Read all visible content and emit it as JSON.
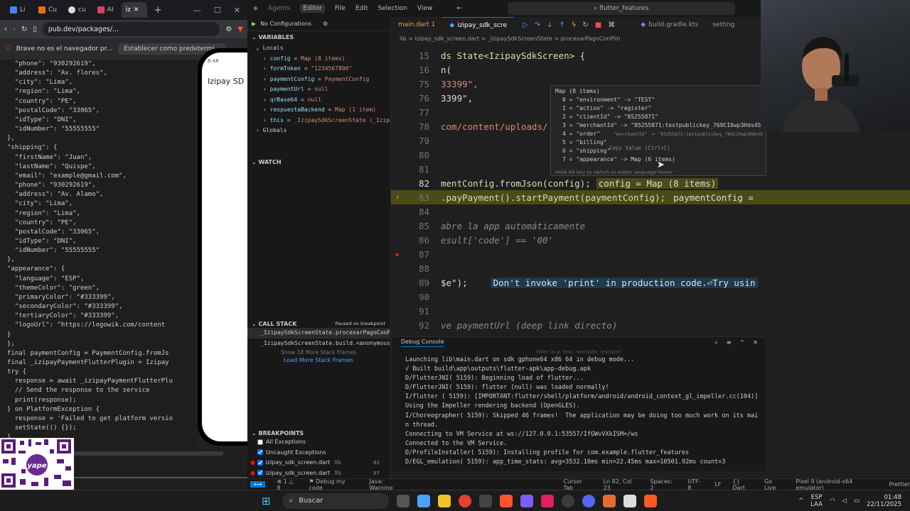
{
  "browser": {
    "tabs": [
      "Li",
      "Cu",
      "cu",
      "AI",
      "iz"
    ],
    "url": "pub.dev/packages/...",
    "brave_msg": "Brave no es el navegador pr...",
    "brave_btn": "Establecer como predetermi...",
    "code_lines": [
      [
        "  \"phone\": \"930292619\","
      ],
      [
        "  \"address\": \"Av. flores\","
      ],
      [
        "  \"city\": \"Lima\","
      ],
      [
        "  \"region\": \"Lima\","
      ],
      [
        "  \"country\": \"PE\","
      ],
      [
        "  \"postalCode\": \"33065\","
      ],
      [
        "  \"idType\": \"DNI\","
      ],
      [
        "  \"idNumber\": \"55555555\""
      ],
      [
        "},"
      ],
      [
        "\"shipping\": {"
      ],
      [
        "  \"firstName\": \"Juan\","
      ],
      [
        "  \"lastName\": \"Quispe\","
      ],
      [
        "  \"email\": \"example@gmail.com\","
      ],
      [
        "  \"phone\": \"930292619\","
      ],
      [
        "  \"address\": \"Av. Alamo\","
      ],
      [
        "  \"city\": \"Lima\","
      ],
      [
        "  \"region\": \"Lima\","
      ],
      [
        "  \"country\": \"PE\","
      ],
      [
        "  \"postalCode\": \"33065\","
      ],
      [
        "  \"idType\": \"DNI\","
      ],
      [
        "  \"idNumber\": \"55555555\""
      ],
      [
        "},"
      ],
      [
        "\"appearance\": {"
      ],
      [
        "  \"language\": \"ESP\","
      ],
      [
        "  \"themeColor\": \"green\","
      ],
      [
        "  \"primaryColor\": \"#333399\","
      ],
      [
        "  \"secondaryColor\": \"#333399\","
      ],
      [
        "  \"tertiaryColor\": \"#333399\","
      ],
      [
        "  \"logoUrl\": \"https://logowik.com/content"
      ],
      [
        "}"
      ],
      [
        "};"
      ],
      [
        "final paymentConfig = PaymentConfig.fromJs"
      ],
      [
        "final _izipayPaymentFlutterPlugin = Izipay"
      ],
      [
        "try {"
      ],
      [
        "  response = await _izipayPaymentFlutterPlu"
      ],
      [
        "  // Send the response to the service"
      ],
      [
        "  print(response);"
      ],
      [
        "} on PlatformException {"
      ],
      [
        "  response = 'Failed to get platform versio"
      ],
      [
        "  setState(() {});"
      ],
      [
        "}"
      ]
    ],
    "phone_time": "6:48",
    "phone_title": "Izipay SD",
    "qr_text": "yape"
  },
  "ide": {
    "menu": [
      "Agents",
      "Editor",
      "File",
      "Edit",
      "Selection",
      "View"
    ],
    "search": "flutter_features",
    "run_config": "No Configurations",
    "sections": {
      "variables": "VARIABLES",
      "locals": "Locals",
      "globals": "Globals",
      "watch": "WATCH",
      "callstack": "CALL STACK",
      "paused": "Paused on breakpoint",
      "breakpoints": "BREAKPOINTS"
    },
    "variables": [
      {
        "name": "config",
        "value": "Map (8 items)"
      },
      {
        "name": "formToken",
        "value": "\"1234567890\""
      },
      {
        "name": "paymentConfig",
        "value": "PaymentConfig"
      },
      {
        "name": "paymentUrl",
        "value": "null"
      },
      {
        "name": "qrBase64",
        "value": "null"
      },
      {
        "name": "respuestaBackend",
        "value": "Map (1 item)"
      },
      {
        "name": "this",
        "value": "_IzipaySdkScreenState (_Izipa..."
      }
    ],
    "callstack": [
      "_IzipaySdkScreenState.procesarPagoConPl",
      "_IzipaySdkScreenState.build.<anonymous"
    ],
    "callstack_more": "Show 18 More Stack Frames",
    "callstack_load": "Load More Stack Frames",
    "breakpoints": [
      {
        "label": "All Exceptions",
        "checked": false
      },
      {
        "label": "Uncaught Exceptions",
        "checked": true
      },
      {
        "label": "izipay_sdk_screen.dart",
        "dir": "lib",
        "line": "83",
        "checked": true
      },
      {
        "label": "izipay_sdk_screen.dart",
        "dir": "lib",
        "line": "87",
        "checked": true
      }
    ],
    "tabs": [
      "main.dart 1",
      "izipay_sdk_scre",
      "build.gradle.kts",
      "setting"
    ],
    "breadcrumb": "lib > izipay_sdk_screen.dart > _IzipaySdkScreenState > procesarPagoConPlin",
    "lines": [
      {
        "n": "15",
        "code": "ds State<IzipaySdkScreen> {"
      },
      {
        "n": "16",
        "code": "n("
      },
      {
        "n": "75",
        "code": "33399\","
      },
      {
        "n": "76",
        "code": "3399\","
      },
      {
        "n": "77",
        "code": ""
      },
      {
        "n": "78",
        "code": "com/content/uploads/"
      },
      {
        "n": "79",
        "code": ""
      },
      {
        "n": "80",
        "code": ""
      },
      {
        "n": "81",
        "code": ""
      },
      {
        "n": "82",
        "code": "mentConfig.fromJson(config);",
        "inline": "config = Map (8 items)"
      },
      {
        "n": "83",
        "code": ".payPayment().startPayment(paymentConfig);",
        "inline": "paymentConfig ="
      },
      {
        "n": "84",
        "code": ""
      },
      {
        "n": "85",
        "code": "abre la app automáticamente"
      },
      {
        "n": "86",
        "code": "esult['code'] == '00'"
      },
      {
        "n": "87",
        "code": ""
      },
      {
        "n": "88",
        "code": ""
      },
      {
        "n": "89",
        "code": "$e\");",
        "lint": "Don't invoke 'print' in production code.⏎Try usin"
      },
      {
        "n": "90",
        "code": ""
      },
      {
        "n": "91",
        "code": ""
      },
      {
        "n": "92",
        "code": "ve paymentUrl (deep link directo)"
      }
    ],
    "hover": {
      "title": "Map (8 items)",
      "items": [
        "0 = \"environment\" -> \"TEST\"",
        "1 = \"action\" -> \"register\"",
        "2 = \"clientId\" -> \"85255871\"",
        "3 = \"merchantId\" -> \"85255871:testpublickey_769CI0wp3Hds45",
        "4 = \"order\"",
        "5 = \"billing\"",
        "6 = \"shipping\"",
        "7 = \"appearance\" -> Map (6 items)"
      ],
      "copy": "Copy Value (Ctrl+C)",
      "tooltip": "\"merchantId\" -> \"85255871:testpublickey_769CI0wp3Hds45...\"",
      "footer": "Hold Alt key to switch to editor language hover"
    },
    "console_title": "Debug Console",
    "console_filter": "Filter (e.g. text, !exclude, \\escape)",
    "console": [
      "Launching lib\\main.dart on sdk gphone64 x86 64 in debug mode...",
      "√ Built build\\app\\outputs\\flutter-apk\\app-debug.apk",
      "D/FlutterJNI( 5159): Beginning load of flutter...",
      "D/FlutterJNI( 5159): flutter (null) was loaded normally!",
      "I/flutter ( 5159): [IMPORTANT:flutter/shell/platform/android/android_context_gl_impeller.cc(104)]",
      "Using the Impeller rendering backend (OpenGLES).",
      "I/Choreographer( 5159): Skipped 46 frames!  The application may be doing too much work on its mai",
      "n thread.",
      "Connecting to VM Service at ws://127.0.0.1:53557/IfGWvVXkISM=/ws",
      "Connected to the VM Service.",
      "D/ProfileInstaller( 5159): Installing profile for com.example.flutter_features",
      "D/EGL_emulation( 5159): app_time_stats: avg=3532.16ms min=22.45ms max=10501.92ms count=3"
    ],
    "status": [
      "⊗ 1 △ 8",
      "⚑ Debug my code",
      "Java: Warning",
      "Cursor Tab",
      "Ln 82, Col 23",
      "Spaces: 2",
      "UTF-8",
      "LF",
      "{} Dart",
      "Go Live",
      "Pixel 9 (android-x64 emulator)",
      "Prettier"
    ]
  },
  "taskbar": {
    "search": "Buscar",
    "lang": "ESP",
    "lang2": "LAA",
    "time": "01:48",
    "date": "22/11/2025"
  }
}
